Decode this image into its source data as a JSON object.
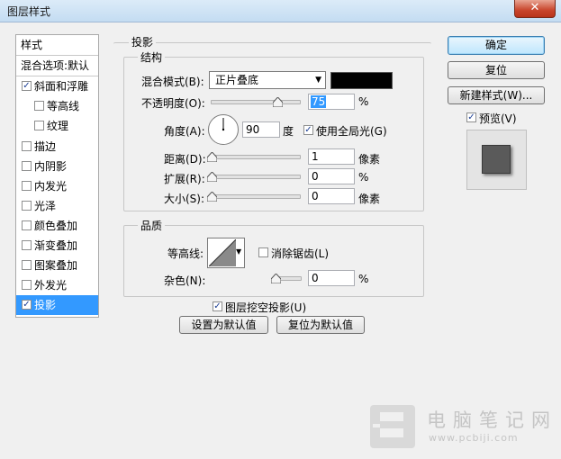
{
  "window": {
    "title": "图层样式",
    "close_glyph": "✕"
  },
  "sidebar": {
    "header": "样式",
    "items": [
      {
        "label": "混合选项:默认",
        "type": "head"
      },
      {
        "label": "斜面和浮雕",
        "checked": true
      },
      {
        "label": "等高线",
        "checked": false,
        "sub": true
      },
      {
        "label": "纹理",
        "checked": false,
        "sub": true
      },
      {
        "label": "描边",
        "checked": false
      },
      {
        "label": "内阴影",
        "checked": false
      },
      {
        "label": "内发光",
        "checked": false
      },
      {
        "label": "光泽",
        "checked": false
      },
      {
        "label": "颜色叠加",
        "checked": false
      },
      {
        "label": "渐变叠加",
        "checked": false
      },
      {
        "label": "图案叠加",
        "checked": false
      },
      {
        "label": "外发光",
        "checked": false
      },
      {
        "label": "投影",
        "checked": true,
        "active": true
      }
    ]
  },
  "panel": {
    "title": "投影",
    "structure": {
      "title": "结构",
      "blend_mode_label": "混合模式(B):",
      "blend_mode_value": "正片叠底",
      "shadow_color": "#000000",
      "opacity_label": "不透明度(O):",
      "opacity_value": "75",
      "opacity_unit": "%",
      "opacity_level": 0.75,
      "angle_label": "角度(A):",
      "angle_value": "90",
      "angle_unit": "度",
      "global_light_label": "使用全局光(G)",
      "global_light_checked": true,
      "distance_label": "距离(D):",
      "distance_value": "1",
      "distance_unit": "像素",
      "spread_label": "扩展(R):",
      "spread_value": "0",
      "spread_unit": "%",
      "size_label": "大小(S):",
      "size_value": "0",
      "size_unit": "像素"
    },
    "quality": {
      "title": "品质",
      "contour_label": "等高线:",
      "antialias_label": "消除锯齿(L)",
      "antialias_checked": false,
      "noise_label": "杂色(N):",
      "noise_value": "0",
      "noise_unit": "%"
    },
    "knockout_label": "图层挖空投影(U)",
    "knockout_checked": true,
    "set_default_label": "设置为默认值",
    "reset_default_label": "复位为默认值"
  },
  "actions": {
    "ok_label": "确定",
    "reset_label": "复位",
    "new_style_label": "新建样式(W)...",
    "preview_label": "预览(V)",
    "preview_checked": true
  },
  "watermark": {
    "cn": "电脑笔记网",
    "en": "www.pcbiji.com"
  },
  "icons": {
    "check": "✓",
    "dropdown": "▼"
  }
}
